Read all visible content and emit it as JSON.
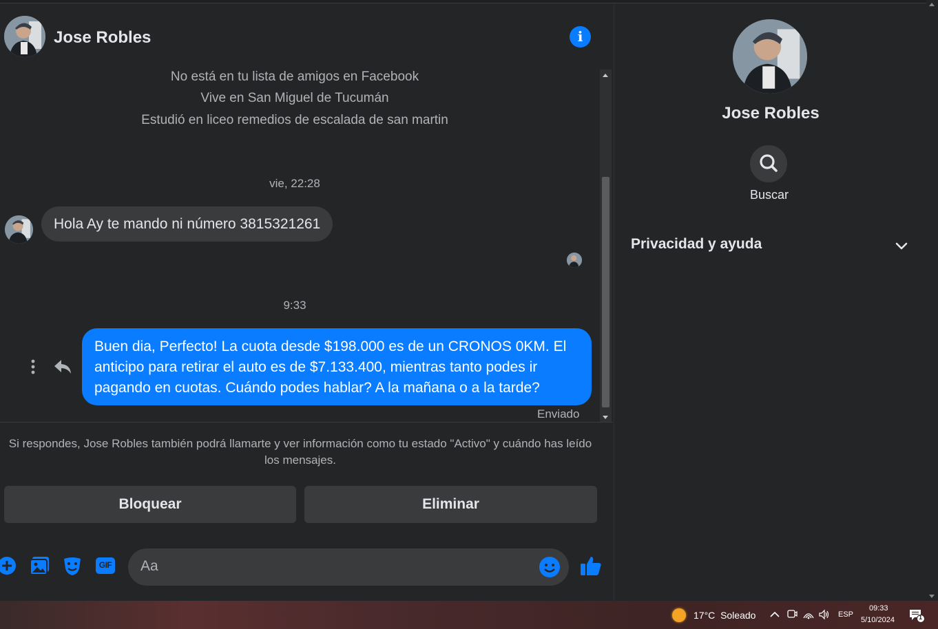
{
  "chat": {
    "contact_name": "Jose Robles",
    "info_glyph": "i",
    "profile_lines": [
      "No está en tu lista de amigos en Facebook",
      "Vive en San Miguel de Tucumán",
      "Estudió en liceo remedios de escalada de san martin"
    ],
    "messages": [
      {
        "timestamp": "vie, 22:28",
        "direction": "incoming",
        "text": "Hola Ay te mando ni número 3815321261"
      },
      {
        "timestamp": "9:33",
        "direction": "outgoing",
        "text": "Buen dia, Perfecto! La cuota desde $198.000 es de un CRONOS 0KM. El anticipo para retirar el auto es de $7.133.400, mientras tanto podes ir pagando en cuotas. Cuándo podes hablar? A la mañana o a la tarde?",
        "status": "Enviado"
      }
    ],
    "notice": "Si respondes, Jose Robles también podrá llamarte y ver información como tu estado \"Activo\" y cuándo has leído los mensajes.",
    "buttons": {
      "block": "Bloquear",
      "delete": "Eliminar"
    },
    "composer": {
      "placeholder": "Aa",
      "icons": [
        "plus-icon",
        "photo-icon",
        "sticker-icon",
        "gif-icon",
        "emoji-icon",
        "like-icon"
      ],
      "gif_text": "GIF"
    }
  },
  "sidebar": {
    "name": "Jose Robles",
    "search_label": "Buscar",
    "privacy_label": "Privacidad y ayuda"
  },
  "taskbar": {
    "temperature": "17°C",
    "weather": "Soleado",
    "language": "ESP",
    "time": "09:33",
    "date": "5/10/2024",
    "notification_count": "1"
  },
  "colors": {
    "background": "#242526",
    "accent": "#0a7cff",
    "bubble_incoming": "#3a3b3c",
    "text_secondary": "#b0b3b8"
  }
}
